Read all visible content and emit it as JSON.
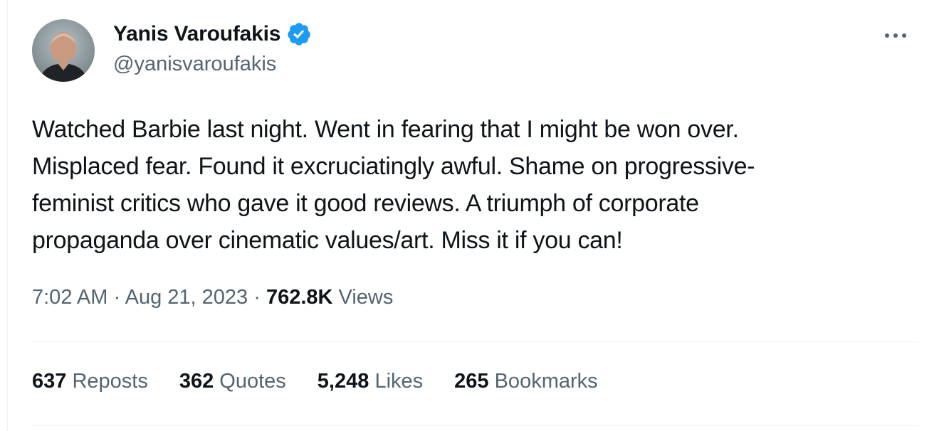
{
  "author": {
    "display_name": "Yanis Varoufakis",
    "handle": "@yanisvaroufakis",
    "verified": true,
    "verified_color": "#1d9bf0"
  },
  "tweet": {
    "text": "Watched Barbie last night. Went in fearing that I might be won over.\nMisplaced fear. Found it excruciatingly awful. Shame on progressive-\nfeminist critics who gave it good reviews. A triumph of corporate\npropaganda over cinematic values/art. Miss it if you can!",
    "time": "7:02 AM",
    "separator": "·",
    "date": "Aug 21, 2023",
    "views_count": "762.8K",
    "views_label": "Views"
  },
  "stats": [
    {
      "count": "637",
      "label": "Reposts"
    },
    {
      "count": "362",
      "label": "Quotes"
    },
    {
      "count": "5,248",
      "label": "Likes"
    },
    {
      "count": "265",
      "label": "Bookmarks"
    }
  ],
  "icons": {
    "verified": "verified-badge-icon",
    "more": "more-options-icon"
  },
  "colors": {
    "text_primary": "#0f1419",
    "text_secondary": "#536471",
    "divider": "#eff3f4",
    "accent": "#1d9bf0"
  }
}
